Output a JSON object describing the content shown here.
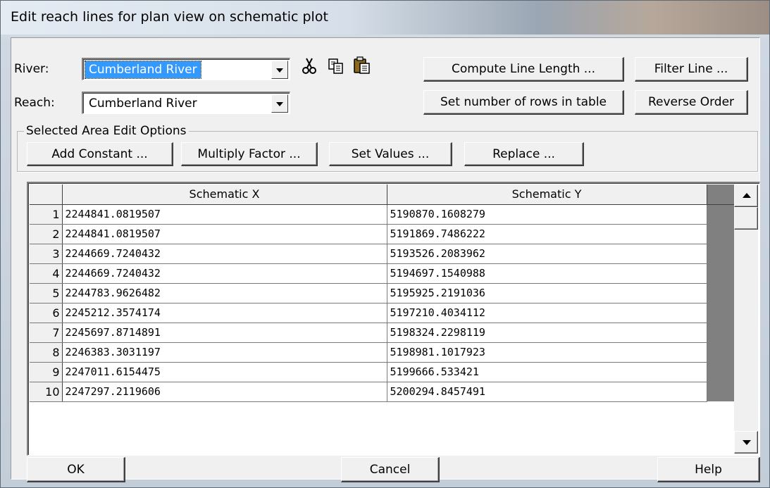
{
  "window": {
    "title": "Edit reach lines for plan view on schematic plot"
  },
  "selectors": {
    "river_label": "River:",
    "river_value": "Cumberland River",
    "reach_label": "Reach:",
    "reach_value": "Cumberland River"
  },
  "toolbar": {
    "icons": [
      "cut-icon",
      "copy-icon",
      "paste-icon"
    ],
    "compute_line_length": "Compute Line Length ...",
    "filter_line": "Filter Line ...",
    "set_rows": "Set number of rows in table",
    "reverse_order": "Reverse Order"
  },
  "edit_options": {
    "group_title": "Selected Area Edit Options",
    "add_constant": "Add Constant ...",
    "multiply_factor": "Multiply Factor ...",
    "set_values": "Set Values ...",
    "replace": "Replace ..."
  },
  "table": {
    "columns": [
      "Schematic X",
      "Schematic Y"
    ],
    "rows": [
      {
        "n": "1",
        "x": "2244841.0819507",
        "y": "5190870.1608279"
      },
      {
        "n": "2",
        "x": "2244841.0819507",
        "y": "5191869.7486222"
      },
      {
        "n": "3",
        "x": "2244669.7240432",
        "y": "5193526.2083962"
      },
      {
        "n": "4",
        "x": "2244669.7240432",
        "y": "5194697.1540988"
      },
      {
        "n": "5",
        "x": "2244783.9626482",
        "y": "5195925.2191036"
      },
      {
        "n": "6",
        "x": "2245212.3574174",
        "y": "5197210.4034112"
      },
      {
        "n": "7",
        "x": "2245697.8714891",
        "y": "5198324.2298119"
      },
      {
        "n": "8",
        "x": "2246383.3031197",
        "y": "5198981.1017923"
      },
      {
        "n": "9",
        "x": "2247011.6154475",
        "y": "5199666.533421"
      },
      {
        "n": "10",
        "x": "2247297.2119606",
        "y": "5200294.8457491"
      }
    ]
  },
  "footer": {
    "ok": "OK",
    "cancel": "Cancel",
    "help": "Help"
  },
  "colors": {
    "selection": "#3399ff",
    "dialog_bg": "#f0f0f0",
    "grid_gray": "#808080"
  }
}
